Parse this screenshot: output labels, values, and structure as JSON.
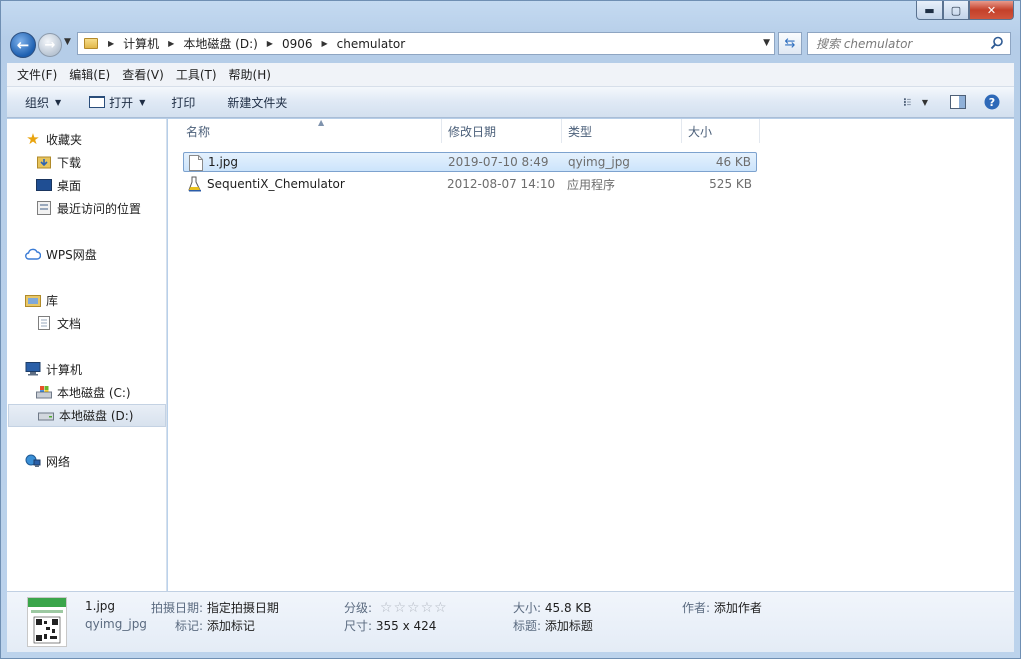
{
  "window": {
    "controls": {
      "minimize": "▬",
      "maximize": "▢",
      "close": "✕"
    }
  },
  "address": {
    "crumbs": [
      "计算机",
      "本地磁盘 (D:)",
      "0906",
      "chemulator"
    ]
  },
  "search": {
    "placeholder": "搜索 chemulator"
  },
  "menubar": {
    "items": [
      "文件(F)",
      "编辑(E)",
      "查看(V)",
      "工具(T)",
      "帮助(H)"
    ]
  },
  "toolbar": {
    "organize": "组织",
    "open": "打开",
    "print": "打印",
    "new_folder": "新建文件夹"
  },
  "sidebar": {
    "favorites": "收藏夹",
    "downloads": "下载",
    "desktop": "桌面",
    "recent": "最近访问的位置",
    "wps": "WPS网盘",
    "libraries": "库",
    "documents": "文档",
    "computer": "计算机",
    "drive_c": "本地磁盘 (C:)",
    "drive_d": "本地磁盘 (D:)",
    "network": "网络"
  },
  "columns": {
    "name": "名称",
    "date": "修改日期",
    "type": "类型",
    "size": "大小"
  },
  "files": [
    {
      "name": "1.jpg",
      "date": "2019-07-10 8:49",
      "type": "qyimg_jpg",
      "size": "46 KB",
      "icon": "image-file-icon"
    },
    {
      "name": "SequentiX_Chemulator",
      "date": "2012-08-07 14:10",
      "type": "应用程序",
      "size": "525 KB",
      "icon": "application-icon"
    }
  ],
  "details": {
    "filename": "1.jpg",
    "filetype": "qyimg_jpg",
    "date_taken_label": "拍摄日期:",
    "date_taken_value": "指定拍摄日期",
    "tags_label": "标记:",
    "tags_value": "添加标记",
    "rating_label": "分级:",
    "rating_stars": 0,
    "dimensions_label": "尺寸:",
    "dimensions_value": "355 x 424",
    "size_label": "大小:",
    "size_value": "45.8 KB",
    "title_label": "标题:",
    "title_value": "添加标题",
    "author_label": "作者:",
    "author_value": "添加作者"
  },
  "colors": {
    "selection_bg": "#cce4fb",
    "selection_border": "#7da2ce",
    "frame": "#b9d1ea"
  }
}
